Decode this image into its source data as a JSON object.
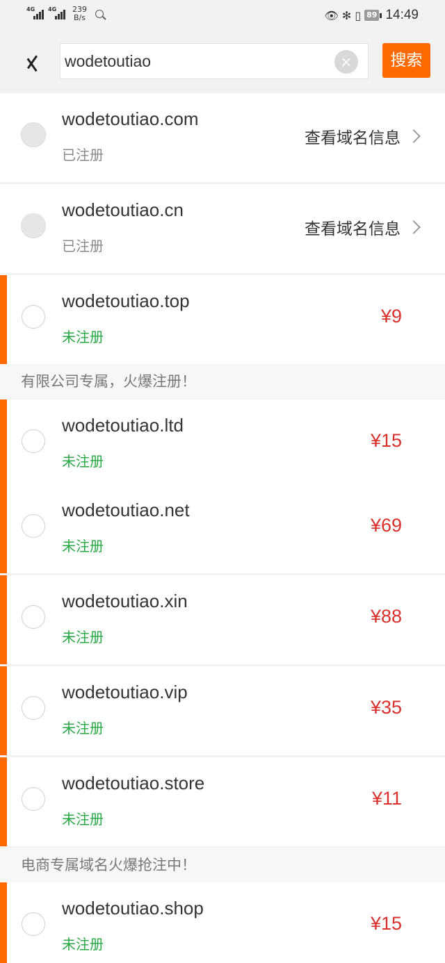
{
  "status_bar": {
    "net_label_1": "4G",
    "net_label_2": "4G",
    "speed_value": "239",
    "speed_unit": "B/s",
    "battery": "89",
    "time": "14:49"
  },
  "search": {
    "query": "wodetoutiao",
    "search_label": "搜索"
  },
  "domains": [
    {
      "name": "wodetoutiao.com",
      "status": "已注册",
      "info_label": "查看域名信息"
    },
    {
      "name": "wodetoutiao.cn",
      "status": "已注册",
      "info_label": "查看域名信息"
    },
    {
      "name": "wodetoutiao.top",
      "status": "未注册",
      "price": "¥9"
    },
    {
      "name": "wodetoutiao.ltd",
      "status": "未注册",
      "price": "¥15"
    },
    {
      "name": "wodetoutiao.net",
      "status": "未注册",
      "price": "¥69"
    },
    {
      "name": "wodetoutiao.xin",
      "status": "未注册",
      "price": "¥88"
    },
    {
      "name": "wodetoutiao.vip",
      "status": "未注册",
      "price": "¥35"
    },
    {
      "name": "wodetoutiao.store",
      "status": "未注册",
      "price": "¥11"
    },
    {
      "name": "wodetoutiao.shop",
      "status": "未注册",
      "price": "¥15"
    }
  ],
  "sections": {
    "company": "有限公司专属，火爆注册！",
    "ecommerce": "电商专属域名火爆抢注中！"
  },
  "colors": {
    "accent": "#ff6a00",
    "price": "#d9302c",
    "available": "#27a744"
  }
}
